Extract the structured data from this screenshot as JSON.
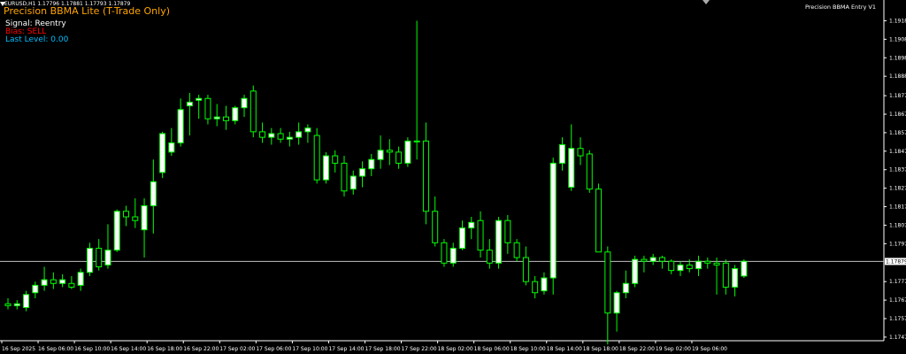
{
  "indicator": {
    "title": "Precision BBMA Lite (T-Trade Only)",
    "signal": "Signal: Reentry",
    "bias": "Bias: SELL",
    "last_level": "Last Level: 0.00",
    "name": "Precision BBMA Entry V1",
    "symbol_line": "EURUSD,H1  1.17796 1.17881 1.17793 1.17879"
  },
  "colors": {
    "bull_fill": "#ffffff",
    "candle_stroke": "#00ff00",
    "title": "#ffa500",
    "bias": "#ff0000",
    "last_level": "#00bfff",
    "price_line": "#c0c0c0"
  },
  "price_axis": {
    "min": 1.1746,
    "max": 1.1923,
    "ticks": [
      "1.19180",
      "1.19080",
      "1.18980",
      "1.18880",
      "1.18775",
      "1.18675",
      "1.18575",
      "1.18475",
      "1.18375",
      "1.18275",
      "1.18175",
      "1.18075",
      "1.17975",
      "1.17770",
      "1.17670",
      "1.17570",
      "1.17470"
    ],
    "current_price": 1.17879,
    "current_label": "1.17879"
  },
  "time_axis": {
    "labels": [
      "16 Sep 2025",
      "16 Sep 06:00",
      "16 Sep 10:00",
      "16 Sep 14:00",
      "16 Sep 18:00",
      "16 Sep 22:00",
      "17 Sep 02:00",
      "17 Sep 06:00",
      "17 Sep 10:00",
      "17 Sep 14:00",
      "17 Sep 18:00",
      "17 Sep 22:00",
      "18 Sep 02:00",
      "18 Sep 06:00",
      "18 Sep 10:00",
      "18 Sep 14:00",
      "18 Sep 18:00",
      "18 Sep 22:00",
      "19 Sep 02:00",
      "19 Sep 06:00"
    ]
  },
  "chart_data": {
    "type": "candlestick",
    "symbol": "EURUSD",
    "timeframe": "H1",
    "ohlc": [
      [
        1.1765,
        1.1768,
        1.1762,
        1.1764
      ],
      [
        1.1764,
        1.1767,
        1.1762,
        1.1765
      ],
      [
        1.1763,
        1.1772,
        1.1761,
        1.177
      ],
      [
        1.1771,
        1.1777,
        1.1768,
        1.1775
      ],
      [
        1.1775,
        1.1785,
        1.1772,
        1.1778
      ],
      [
        1.1778,
        1.1782,
        1.1773,
        1.1776
      ],
      [
        1.1776,
        1.1781,
        1.1774,
        1.1778
      ],
      [
        1.1776,
        1.178,
        1.1773,
        1.1774
      ],
      [
        1.1775,
        1.1784,
        1.1772,
        1.1782
      ],
      [
        1.1782,
        1.1798,
        1.178,
        1.1795
      ],
      [
        1.1795,
        1.18,
        1.1783,
        1.1785
      ],
      [
        1.1786,
        1.1808,
        1.1784,
        1.1794
      ],
      [
        1.1794,
        1.1816,
        1.1793,
        1.1815
      ],
      [
        1.1815,
        1.1818,
        1.1807,
        1.1812
      ],
      [
        1.1812,
        1.1822,
        1.1806,
        1.181
      ],
      [
        1.1805,
        1.1822,
        1.179,
        1.1818
      ],
      [
        1.1818,
        1.1843,
        1.1803,
        1.1831
      ],
      [
        1.1836,
        1.1858,
        1.1833,
        1.1857
      ],
      [
        1.1847,
        1.186,
        1.1845,
        1.1852
      ],
      [
        1.1852,
        1.1876,
        1.185,
        1.187
      ],
      [
        1.1872,
        1.1879,
        1.1856,
        1.1874
      ],
      [
        1.1875,
        1.1878,
        1.1865,
        1.1876
      ],
      [
        1.1876,
        1.1878,
        1.1862,
        1.1865
      ],
      [
        1.1865,
        1.1873,
        1.1861,
        1.1866
      ],
      [
        1.1866,
        1.1872,
        1.1859,
        1.1864
      ],
      [
        1.1864,
        1.1872,
        1.1862,
        1.1871
      ],
      [
        1.1871,
        1.1878,
        1.1866,
        1.1876
      ],
      [
        1.188,
        1.1883,
        1.1855,
        1.1858
      ],
      [
        1.1858,
        1.1863,
        1.1852,
        1.1855
      ],
      [
        1.1855,
        1.186,
        1.1851,
        1.1857
      ],
      [
        1.1857,
        1.186,
        1.1852,
        1.1854
      ],
      [
        1.1854,
        1.1858,
        1.185,
        1.1855
      ],
      [
        1.1855,
        1.1863,
        1.1851,
        1.1858
      ],
      [
        1.1858,
        1.1862,
        1.1852,
        1.186
      ],
      [
        1.1856,
        1.186,
        1.183,
        1.1832
      ],
      [
        1.1832,
        1.1847,
        1.183,
        1.1845
      ],
      [
        1.1845,
        1.1848,
        1.1836,
        1.1841
      ],
      [
        1.1841,
        1.1845,
        1.1823,
        1.1826
      ],
      [
        1.1827,
        1.1837,
        1.1824,
        1.1834
      ],
      [
        1.1834,
        1.1842,
        1.1828,
        1.1838
      ],
      [
        1.1838,
        1.1846,
        1.1834,
        1.1843
      ],
      [
        1.1843,
        1.1856,
        1.1838,
        1.1848
      ],
      [
        1.1848,
        1.1854,
        1.184,
        1.1847
      ],
      [
        1.1847,
        1.185,
        1.1838,
        1.1841
      ],
      [
        1.1841,
        1.1855,
        1.1839,
        1.1853
      ],
      [
        1.1853,
        1.1918,
        1.1843,
        1.1853
      ],
      [
        1.1853,
        1.1863,
        1.1808,
        1.1815
      ],
      [
        1.1815,
        1.1823,
        1.1796,
        1.1798
      ],
      [
        1.1798,
        1.18,
        1.1785,
        1.1787
      ],
      [
        1.1787,
        1.1798,
        1.1785,
        1.1795
      ],
      [
        1.1795,
        1.181,
        1.1794,
        1.1806
      ],
      [
        1.1806,
        1.1812,
        1.18,
        1.1809
      ],
      [
        1.181,
        1.1815,
        1.179,
        1.1794
      ],
      [
        1.1794,
        1.18,
        1.1784,
        1.1787
      ],
      [
        1.1787,
        1.1812,
        1.1784,
        1.181
      ],
      [
        1.181,
        1.1813,
        1.1792,
        1.1798
      ],
      [
        1.1798,
        1.18,
        1.1788,
        1.179
      ],
      [
        1.179,
        1.1796,
        1.1775,
        1.1777
      ],
      [
        1.1777,
        1.178,
        1.1768,
        1.1771
      ],
      [
        1.1772,
        1.1782,
        1.177,
        1.1779
      ],
      [
        1.1779,
        1.1844,
        1.177,
        1.1841
      ],
      [
        1.1841,
        1.1855,
        1.1837,
        1.1851
      ],
      [
        1.1828,
        1.1862,
        1.1826,
        1.1849
      ],
      [
        1.1849,
        1.1855,
        1.184,
        1.1845
      ],
      [
        1.1846,
        1.1848,
        1.1825,
        1.1827
      ],
      [
        1.1827,
        1.183,
        1.1793,
        1.1793
      ],
      [
        1.1793,
        1.1796,
        1.1743,
        1.176
      ],
      [
        1.176,
        1.1772,
        1.175,
        1.1771
      ],
      [
        1.1771,
        1.1783,
        1.1768,
        1.1776
      ],
      [
        1.1776,
        1.1791,
        1.1774,
        1.1789
      ],
      [
        1.1789,
        1.1791,
        1.1782,
        1.1788
      ],
      [
        1.1788,
        1.1792,
        1.1786,
        1.179
      ],
      [
        1.179,
        1.1791,
        1.1784,
        1.1788
      ],
      [
        1.1788,
        1.1789,
        1.1781,
        1.1783
      ],
      [
        1.1783,
        1.1788,
        1.178,
        1.1786
      ],
      [
        1.1786,
        1.1789,
        1.1782,
        1.1784
      ],
      [
        1.1784,
        1.1791,
        1.178,
        1.1788
      ],
      [
        1.1788,
        1.179,
        1.1784,
        1.1787
      ],
      [
        1.1787,
        1.179,
        1.177,
        1.1786
      ],
      [
        1.1787,
        1.1789,
        1.177,
        1.1774
      ],
      [
        1.1774,
        1.1786,
        1.1769,
        1.1784
      ],
      [
        1.178,
        1.1789,
        1.1779,
        1.1788
      ]
    ]
  }
}
